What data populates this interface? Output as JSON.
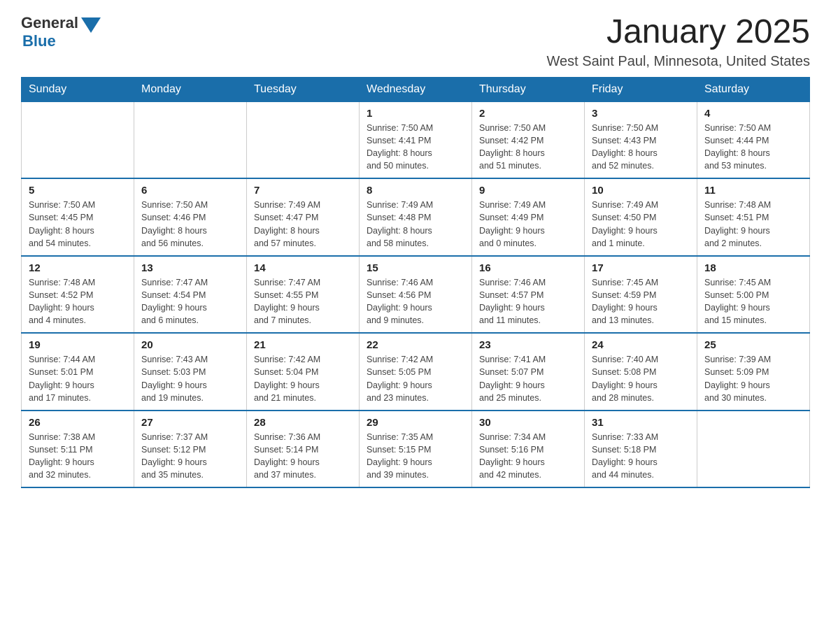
{
  "logo": {
    "text_general": "General",
    "text_blue": "Blue"
  },
  "title": "January 2025",
  "subtitle": "West Saint Paul, Minnesota, United States",
  "days_of_week": [
    "Sunday",
    "Monday",
    "Tuesday",
    "Wednesday",
    "Thursday",
    "Friday",
    "Saturday"
  ],
  "weeks": [
    [
      {
        "day": "",
        "info": ""
      },
      {
        "day": "",
        "info": ""
      },
      {
        "day": "",
        "info": ""
      },
      {
        "day": "1",
        "info": "Sunrise: 7:50 AM\nSunset: 4:41 PM\nDaylight: 8 hours\nand 50 minutes."
      },
      {
        "day": "2",
        "info": "Sunrise: 7:50 AM\nSunset: 4:42 PM\nDaylight: 8 hours\nand 51 minutes."
      },
      {
        "day": "3",
        "info": "Sunrise: 7:50 AM\nSunset: 4:43 PM\nDaylight: 8 hours\nand 52 minutes."
      },
      {
        "day": "4",
        "info": "Sunrise: 7:50 AM\nSunset: 4:44 PM\nDaylight: 8 hours\nand 53 minutes."
      }
    ],
    [
      {
        "day": "5",
        "info": "Sunrise: 7:50 AM\nSunset: 4:45 PM\nDaylight: 8 hours\nand 54 minutes."
      },
      {
        "day": "6",
        "info": "Sunrise: 7:50 AM\nSunset: 4:46 PM\nDaylight: 8 hours\nand 56 minutes."
      },
      {
        "day": "7",
        "info": "Sunrise: 7:49 AM\nSunset: 4:47 PM\nDaylight: 8 hours\nand 57 minutes."
      },
      {
        "day": "8",
        "info": "Sunrise: 7:49 AM\nSunset: 4:48 PM\nDaylight: 8 hours\nand 58 minutes."
      },
      {
        "day": "9",
        "info": "Sunrise: 7:49 AM\nSunset: 4:49 PM\nDaylight: 9 hours\nand 0 minutes."
      },
      {
        "day": "10",
        "info": "Sunrise: 7:49 AM\nSunset: 4:50 PM\nDaylight: 9 hours\nand 1 minute."
      },
      {
        "day": "11",
        "info": "Sunrise: 7:48 AM\nSunset: 4:51 PM\nDaylight: 9 hours\nand 2 minutes."
      }
    ],
    [
      {
        "day": "12",
        "info": "Sunrise: 7:48 AM\nSunset: 4:52 PM\nDaylight: 9 hours\nand 4 minutes."
      },
      {
        "day": "13",
        "info": "Sunrise: 7:47 AM\nSunset: 4:54 PM\nDaylight: 9 hours\nand 6 minutes."
      },
      {
        "day": "14",
        "info": "Sunrise: 7:47 AM\nSunset: 4:55 PM\nDaylight: 9 hours\nand 7 minutes."
      },
      {
        "day": "15",
        "info": "Sunrise: 7:46 AM\nSunset: 4:56 PM\nDaylight: 9 hours\nand 9 minutes."
      },
      {
        "day": "16",
        "info": "Sunrise: 7:46 AM\nSunset: 4:57 PM\nDaylight: 9 hours\nand 11 minutes."
      },
      {
        "day": "17",
        "info": "Sunrise: 7:45 AM\nSunset: 4:59 PM\nDaylight: 9 hours\nand 13 minutes."
      },
      {
        "day": "18",
        "info": "Sunrise: 7:45 AM\nSunset: 5:00 PM\nDaylight: 9 hours\nand 15 minutes."
      }
    ],
    [
      {
        "day": "19",
        "info": "Sunrise: 7:44 AM\nSunset: 5:01 PM\nDaylight: 9 hours\nand 17 minutes."
      },
      {
        "day": "20",
        "info": "Sunrise: 7:43 AM\nSunset: 5:03 PM\nDaylight: 9 hours\nand 19 minutes."
      },
      {
        "day": "21",
        "info": "Sunrise: 7:42 AM\nSunset: 5:04 PM\nDaylight: 9 hours\nand 21 minutes."
      },
      {
        "day": "22",
        "info": "Sunrise: 7:42 AM\nSunset: 5:05 PM\nDaylight: 9 hours\nand 23 minutes."
      },
      {
        "day": "23",
        "info": "Sunrise: 7:41 AM\nSunset: 5:07 PM\nDaylight: 9 hours\nand 25 minutes."
      },
      {
        "day": "24",
        "info": "Sunrise: 7:40 AM\nSunset: 5:08 PM\nDaylight: 9 hours\nand 28 minutes."
      },
      {
        "day": "25",
        "info": "Sunrise: 7:39 AM\nSunset: 5:09 PM\nDaylight: 9 hours\nand 30 minutes."
      }
    ],
    [
      {
        "day": "26",
        "info": "Sunrise: 7:38 AM\nSunset: 5:11 PM\nDaylight: 9 hours\nand 32 minutes."
      },
      {
        "day": "27",
        "info": "Sunrise: 7:37 AM\nSunset: 5:12 PM\nDaylight: 9 hours\nand 35 minutes."
      },
      {
        "day": "28",
        "info": "Sunrise: 7:36 AM\nSunset: 5:14 PM\nDaylight: 9 hours\nand 37 minutes."
      },
      {
        "day": "29",
        "info": "Sunrise: 7:35 AM\nSunset: 5:15 PM\nDaylight: 9 hours\nand 39 minutes."
      },
      {
        "day": "30",
        "info": "Sunrise: 7:34 AM\nSunset: 5:16 PM\nDaylight: 9 hours\nand 42 minutes."
      },
      {
        "day": "31",
        "info": "Sunrise: 7:33 AM\nSunset: 5:18 PM\nDaylight: 9 hours\nand 44 minutes."
      },
      {
        "day": "",
        "info": ""
      }
    ]
  ]
}
